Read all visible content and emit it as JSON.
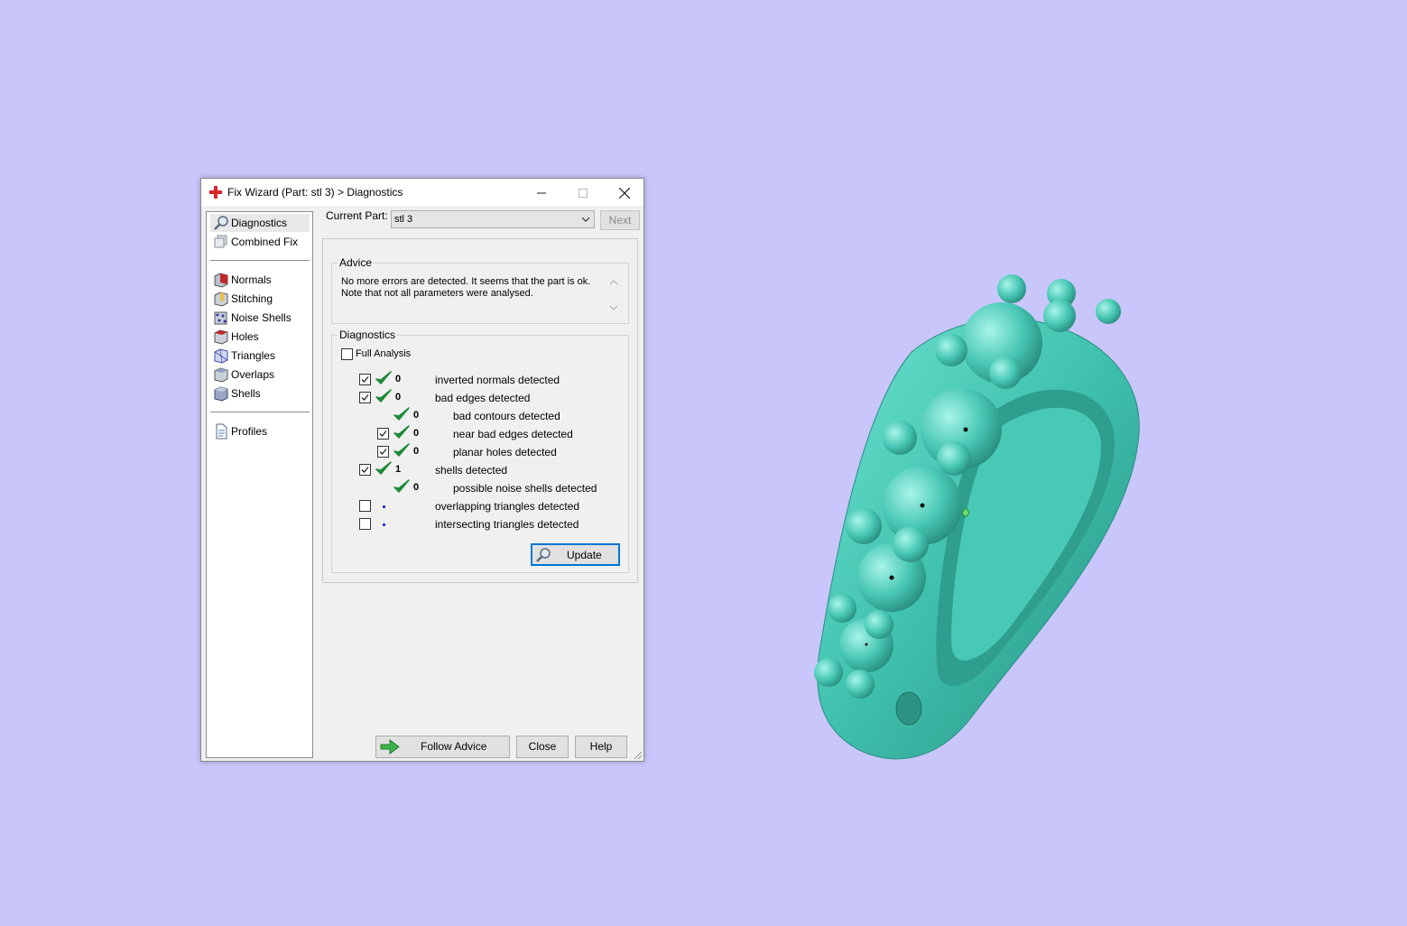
{
  "window": {
    "title": "Fix Wizard (Part: stl 3) > Diagnostics"
  },
  "sidebar": {
    "groups": [
      [
        {
          "label": "Diagnostics",
          "icon": "magnifier-icon",
          "selected": true
        },
        {
          "label": "Combined Fix",
          "icon": "combined-fix-icon"
        }
      ],
      [
        {
          "label": "Normals",
          "icon": "normals-icon"
        },
        {
          "label": "Stitching",
          "icon": "stitching-icon"
        },
        {
          "label": "Noise Shells",
          "icon": "noise-shells-icon"
        },
        {
          "label": "Holes",
          "icon": "holes-icon"
        },
        {
          "label": "Triangles",
          "icon": "triangles-icon"
        },
        {
          "label": "Overlaps",
          "icon": "overlaps-icon"
        },
        {
          "label": "Shells",
          "icon": "shells-icon"
        }
      ],
      [
        {
          "label": "Profiles",
          "icon": "profiles-icon"
        }
      ]
    ]
  },
  "current_part": {
    "label": "Current Part:",
    "value": "stl 3",
    "next_label": "Next"
  },
  "advice": {
    "title": "Advice",
    "line1": "No more errors are detected. It seems that the part is ok.",
    "line2": "Note that not all parameters were analysed."
  },
  "diagnostics": {
    "title": "Diagnostics",
    "full_analysis_label": "Full Analysis",
    "full_analysis_checked": false,
    "rows": [
      {
        "label": "inverted normals detected",
        "count": "0",
        "checked": true,
        "has_checkbox": true,
        "ok": true,
        "indent": 0
      },
      {
        "label": "bad edges detected",
        "count": "0",
        "checked": true,
        "has_checkbox": true,
        "ok": true,
        "indent": 0
      },
      {
        "label": "bad contours detected",
        "count": "0",
        "checked": false,
        "has_checkbox": false,
        "ok": true,
        "indent": 1
      },
      {
        "label": "near bad edges detected",
        "count": "0",
        "checked": true,
        "has_checkbox": true,
        "ok": true,
        "indent": 1
      },
      {
        "label": "planar holes detected",
        "count": "0",
        "checked": true,
        "has_checkbox": true,
        "ok": true,
        "indent": 1
      },
      {
        "label": "shells detected",
        "count": "1",
        "checked": true,
        "has_checkbox": true,
        "ok": true,
        "indent": 0
      },
      {
        "label": "possible noise shells detected",
        "count": "0",
        "checked": false,
        "has_checkbox": false,
        "ok": true,
        "indent": 1
      },
      {
        "label": "overlapping triangles detected",
        "count": "",
        "checked": false,
        "has_checkbox": true,
        "ok": false,
        "indent": 0
      },
      {
        "label": "intersecting triangles detected",
        "count": "",
        "checked": false,
        "has_checkbox": true,
        "ok": false,
        "indent": 0
      }
    ],
    "update_label": "Update"
  },
  "footer": {
    "follow_label": "Follow Advice",
    "close_label": "Close",
    "help_label": "Help"
  },
  "colors": {
    "background": "#c8c6fb",
    "model": "#3fbfad",
    "check_green": "#1e8a3a",
    "focus_blue": "#0078d7"
  }
}
